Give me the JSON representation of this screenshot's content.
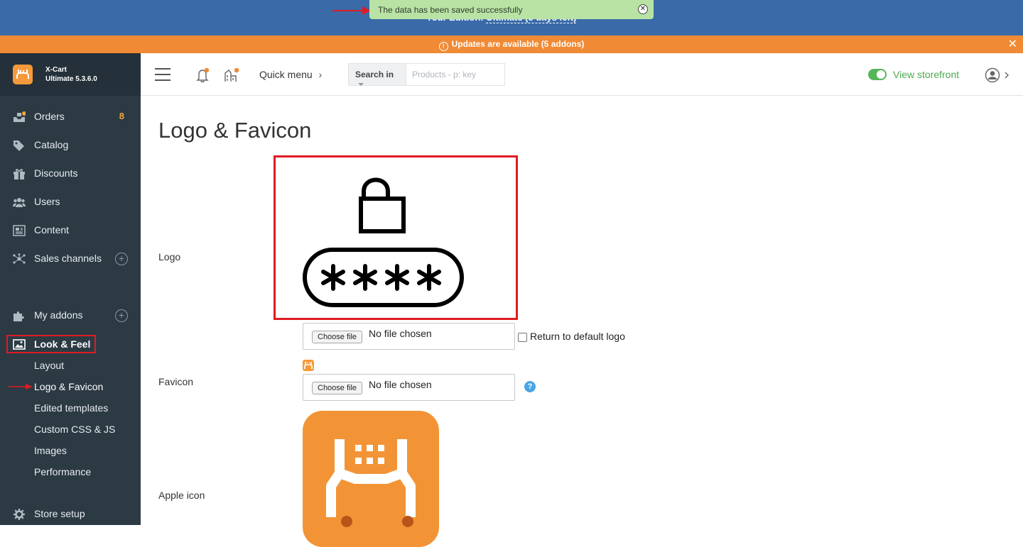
{
  "topbar": {
    "edition_prefix": "Your Edition:",
    "edition_value": "Ultimate (5 days left)",
    "toast_message": "The data has been saved successfully"
  },
  "updates_bar": {
    "message": "Updates are available (5 addons)"
  },
  "brand": {
    "name": "X-Cart",
    "version": "Ultimate 5.3.6.0"
  },
  "sidebar": {
    "items": [
      {
        "label": "Orders",
        "count": "8",
        "icon": "orders-icon"
      },
      {
        "label": "Catalog",
        "icon": "tag-icon"
      },
      {
        "label": "Discounts",
        "icon": "gift-icon"
      },
      {
        "label": "Users",
        "icon": "users-icon"
      },
      {
        "label": "Content",
        "icon": "newspaper-icon"
      },
      {
        "label": "Sales channels",
        "icon": "network-icon"
      },
      {
        "label": "My addons",
        "icon": "puzzle-icon"
      },
      {
        "label": "Look & Feel",
        "icon": "image-icon"
      },
      {
        "label": "Store setup",
        "icon": "gear-icon"
      }
    ],
    "look_feel_subitems": [
      "Layout",
      "Logo & Favicon",
      "Edited templates",
      "Custom CSS & JS",
      "Images",
      "Performance"
    ]
  },
  "header": {
    "quick_menu": "Quick menu",
    "search_in": "Search in",
    "search_placeholder": "Products - p: key",
    "view_storefront": "View storefront"
  },
  "main": {
    "title": "Logo & Favicon",
    "logo_label": "Logo",
    "favicon_label": "Favicon",
    "apple_icon_label": "Apple icon",
    "choose_file": "Choose file",
    "no_file": "No file chosen",
    "return_default": "Return to default logo"
  },
  "colors": {
    "topbar": "#3a6ba8",
    "updates": "#f08a35",
    "sidebar": "#2c3a44",
    "accent_orange": "#f59a3c",
    "storefront_green": "#4fa94f",
    "highlight_red": "#e01b22"
  }
}
